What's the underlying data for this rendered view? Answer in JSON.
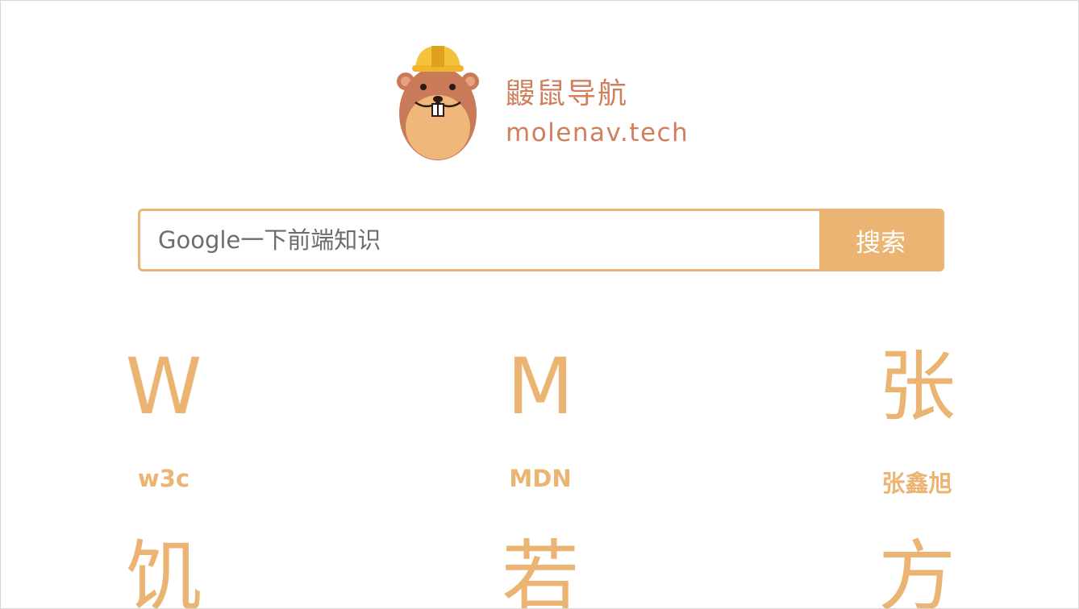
{
  "brand": {
    "name_cn": "鼹鼠导航",
    "domain": "molenav.tech"
  },
  "search": {
    "placeholder": "Google一下前端知识",
    "button_label": "搜索"
  },
  "sites": [
    {
      "initial": "W",
      "label": "w3c"
    },
    {
      "initial": "M",
      "label": "MDN"
    },
    {
      "initial": "张",
      "label": "张鑫旭"
    },
    {
      "initial": "饥",
      "label": ""
    },
    {
      "initial": "若",
      "label": ""
    },
    {
      "initial": "方",
      "label": ""
    }
  ],
  "colors": {
    "accent": "#ebb472",
    "brand_text": "#d07f5d"
  },
  "icons": {
    "logo": "mole-with-hardhat-logo"
  }
}
